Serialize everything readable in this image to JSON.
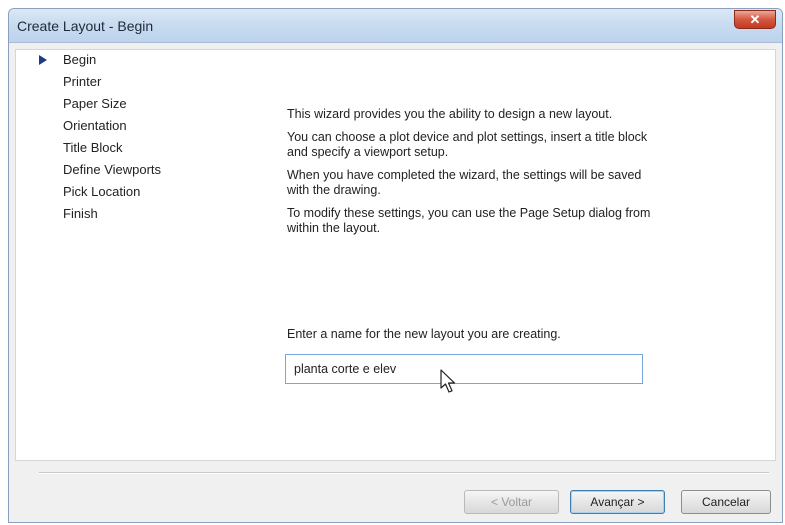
{
  "window": {
    "title": "Create Layout - Begin",
    "close_glyph": "✕"
  },
  "steps": [
    {
      "label": "Begin",
      "current": true
    },
    {
      "label": "Printer",
      "current": false
    },
    {
      "label": "Paper Size",
      "current": false
    },
    {
      "label": "Orientation",
      "current": false
    },
    {
      "label": "Title Block",
      "current": false
    },
    {
      "label": "Define Viewports",
      "current": false
    },
    {
      "label": "Pick Location",
      "current": false
    },
    {
      "label": "Finish",
      "current": false
    }
  ],
  "description": [
    "This wizard provides you the ability to design a new layout.",
    "You can choose a plot device and plot settings, insert a title block and specify a viewport setup.",
    "When you have completed the wizard, the settings will be saved with the drawing.",
    "To modify these settings, you can use the Page Setup dialog from within the layout."
  ],
  "layout_name": {
    "prompt": "Enter a name for the new layout you are creating.",
    "value": "planta corte e elev"
  },
  "buttons": {
    "back": "< Voltar",
    "next": "Avançar >",
    "cancel": "Cancelar"
  },
  "colors": {
    "current_step_arrow": "#1f3a8a",
    "close_button": "#c23a23"
  },
  "icons": {
    "current_step": "current-step-arrow-icon",
    "close": "close-icon",
    "cursor": "mouse-cursor-icon"
  }
}
